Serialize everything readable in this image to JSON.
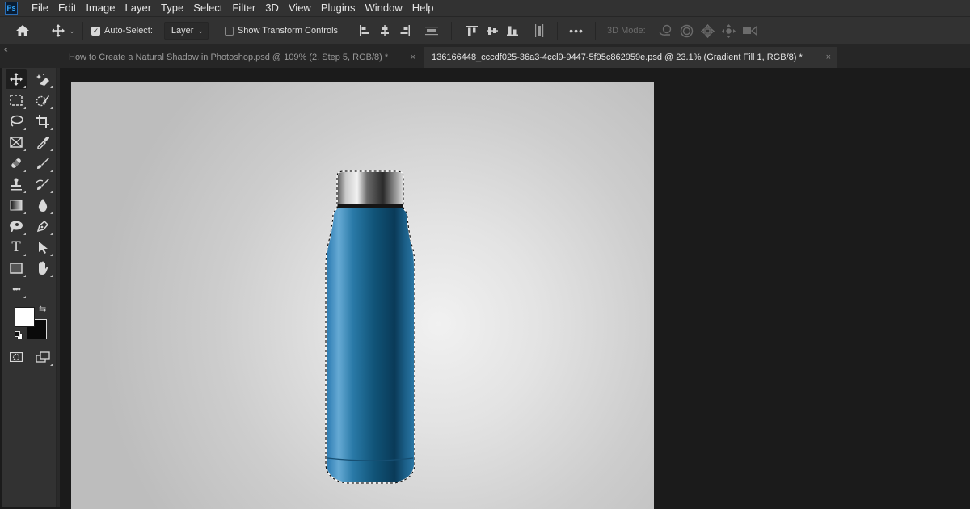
{
  "app": {
    "logo": "Ps",
    "menu": [
      "File",
      "Edit",
      "Image",
      "Layer",
      "Type",
      "Select",
      "Filter",
      "3D",
      "View",
      "Plugins",
      "Window",
      "Help"
    ]
  },
  "options_bar": {
    "home_icon": "home-icon",
    "move_tool_icon": "move-icon",
    "auto_select_label": "Auto-Select:",
    "auto_select_checked": true,
    "auto_select_target": "Layer",
    "show_transform_label": "Show Transform Controls",
    "show_transform_checked": false,
    "align_buttons": [
      "align-left-edges",
      "align-horizontal-centers",
      "align-right-edges",
      "distribute-horizontal",
      "align-top-edges",
      "align-vertical-centers",
      "align-bottom-edges",
      "distribute-vertical"
    ],
    "more_label": "•••",
    "mode_3d_label": "3D Mode:",
    "mode_3d_buttons": [
      "orbit-3d",
      "roll-3d",
      "drag-3d",
      "slide-3d",
      "scale-3d"
    ]
  },
  "tabs": [
    {
      "label": "How to Create a Natural Shadow in Photoshop.psd @ 109% (2. Step 5, RGB/8) *",
      "active": false,
      "close": "×"
    },
    {
      "label": "136166448_cccdf025-36a3-4ccl9-9447-5f95c862959e.psd @ 23.1% (Gradient Fill 1, RGB/8) *",
      "active": true,
      "close": "×"
    }
  ],
  "tabs_collapse": "‹‹",
  "toolbar": {
    "tools": [
      "move-tool",
      "magic-eraser-tool",
      "rectangular-marquee-tool",
      "quick-selection-tool",
      "lasso-tool",
      "crop-tool",
      "frame-tool",
      "eyedropper-tool",
      "healing-brush-tool",
      "brush-tool",
      "clone-stamp-tool",
      "history-brush-tool",
      "gradient-tool",
      "blur-tool",
      "dodge-tool",
      "pen-tool",
      "type-tool",
      "path-selection-tool",
      "rectangle-tool",
      "hand-tool",
      "edit-toolbar"
    ],
    "type_tool_glyph": "T",
    "more_glyph": "•••",
    "foreground_color": "#ffffff",
    "background_color": "#0a0a0a",
    "swap_glyph": "⇆"
  },
  "document": {
    "zoom": "23.1%",
    "active_layer": "Gradient Fill 1",
    "bottle_color": "#2a7aa8",
    "background_gradient": [
      "#f1f1f1",
      "#bdbdbd"
    ]
  }
}
